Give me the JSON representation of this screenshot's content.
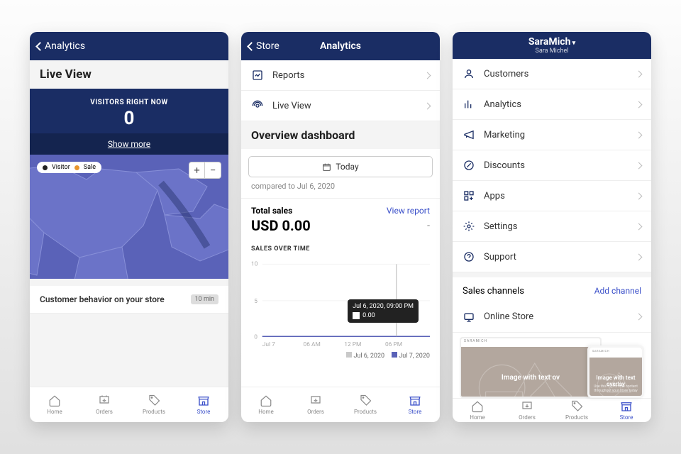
{
  "phone1": {
    "back": "Analytics",
    "section": "Live View",
    "visitors_label": "VISITORS RIGHT NOW",
    "visitors_value": "0",
    "show_more": "Show more",
    "legend_visitor": "Visitor",
    "legend_sale": "Sale",
    "behavior": "Customer behavior on your store",
    "badge": "10 min"
  },
  "phone2": {
    "back": "Store",
    "title": "Analytics",
    "items": [
      "Reports",
      "Live View"
    ],
    "overview": "Overview dashboard",
    "today": "Today",
    "compared": "compared to Jul 6, 2020",
    "total_sales": "Total sales",
    "view_report": "View report",
    "amount": "USD 0.00",
    "dash": "-",
    "sot": "SALES OVER TIME",
    "tooltip_time": "Jul 6, 2020, 09:00 PM",
    "tooltip_val": "0.00",
    "xticks": [
      "Jul 7",
      "06 AM",
      "12 PM",
      "06 PM"
    ],
    "legend": [
      "Jul 6, 2020",
      "Jul 7, 2020"
    ]
  },
  "phone3": {
    "user": "SaraMich",
    "user_full": "Sara Michel",
    "menu": [
      "Customers",
      "Analytics",
      "Marketing",
      "Discounts",
      "Apps",
      "Settings",
      "Support"
    ],
    "sales_channels": "Sales channels",
    "add_channel": "Add channel",
    "online_store": "Online Store",
    "overlay1": "Image with text ov",
    "overlay2": "Image with text overlay",
    "preview_brand": "SARAMICH"
  },
  "tabs": [
    "Home",
    "Orders",
    "Products",
    "Store"
  ],
  "chart_data": {
    "type": "line",
    "title": "SALES OVER TIME",
    "xlabel": "",
    "ylabel": "",
    "ylim": [
      0,
      10
    ],
    "x_ticks": [
      "Jul 7",
      "06 AM",
      "12 PM",
      "06 PM"
    ],
    "series": [
      {
        "name": "Jul 6, 2020",
        "color": "#c9c9c9",
        "values": [
          0,
          0,
          0,
          0,
          0,
          0,
          0,
          0,
          0,
          0,
          0,
          0,
          0,
          0,
          0,
          0,
          0,
          0,
          0,
          0,
          0,
          0,
          0,
          0
        ]
      },
      {
        "name": "Jul 7, 2020",
        "color": "#5a62b8",
        "values": [
          0,
          0,
          0,
          0,
          0,
          0,
          0,
          0,
          0,
          0,
          0,
          0,
          0,
          0,
          0,
          0,
          0,
          0,
          0,
          0,
          0
        ]
      }
    ],
    "tooltip": {
      "label": "Jul 6, 2020, 09:00 PM",
      "value": 0.0
    }
  }
}
